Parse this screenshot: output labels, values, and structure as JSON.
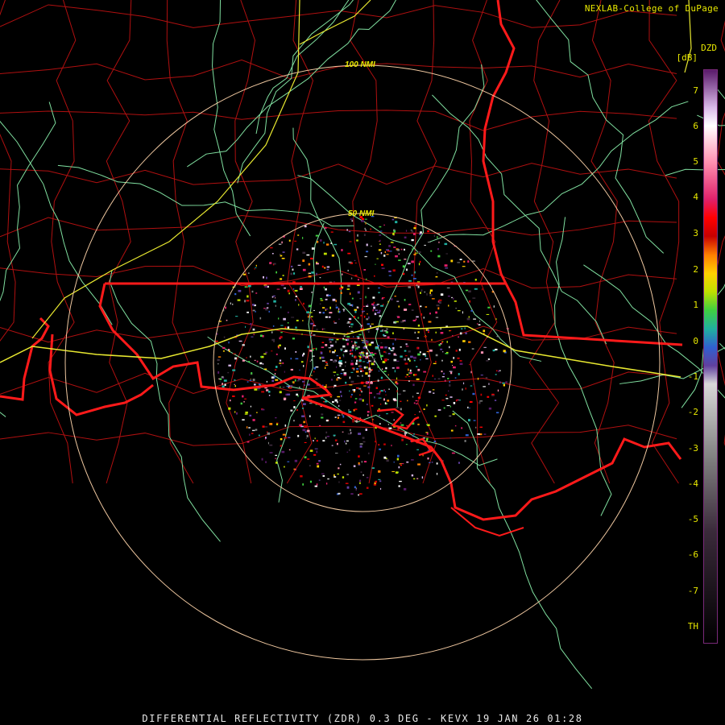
{
  "credit": "NEXLAB-College of DuPage",
  "product_code": "DZD",
  "units": "[dB]",
  "range_labels": [
    "100 NMI",
    "50 NMI"
  ],
  "caption": "DIFFERENTIAL REFLECTIVITY (ZDR) 0.3 DEG - KEVX 19 JAN 26 01:28",
  "scale": {
    "ticks": [
      "7",
      "6",
      "5",
      "4",
      "3",
      "2",
      "1",
      "0",
      "-1",
      "-2",
      "-3",
      "-4",
      "-5",
      "-6",
      "-7",
      "TH"
    ],
    "stops": [
      {
        "value": 7.5,
        "color": "#5a1a6a"
      },
      {
        "value": 6.5,
        "color": "#d8b8e8"
      },
      {
        "value": 6.0,
        "color": "#ffffff"
      },
      {
        "value": 5.0,
        "color": "#ff90b0"
      },
      {
        "value": 4.0,
        "color": "#e0206a"
      },
      {
        "value": 3.5,
        "color": "#ff0000"
      },
      {
        "value": 3.0,
        "color": "#c80000"
      },
      {
        "value": 2.5,
        "color": "#ff8000"
      },
      {
        "value": 2.0,
        "color": "#ffd000"
      },
      {
        "value": 1.5,
        "color": "#c0e000"
      },
      {
        "value": 1.0,
        "color": "#40d040"
      },
      {
        "value": 0.5,
        "color": "#20b0a0"
      },
      {
        "value": 0.0,
        "color": "#3060d0"
      },
      {
        "value": -0.5,
        "color": "#6040a0"
      },
      {
        "value": -1.0,
        "color": "#d8d8d8"
      },
      {
        "value": -3.0,
        "color": "#808080"
      },
      {
        "value": -5.0,
        "color": "#3a2a3a"
      },
      {
        "value": -8.0,
        "color": "#000000"
      }
    ]
  },
  "colors": {
    "county_lines": "#b01010",
    "state_lines": "#ff1a1a",
    "highways": "#80e0a0",
    "interstates": "#e8e830",
    "range_rings": "#f0c8a0",
    "label_text": "#e8e800"
  }
}
